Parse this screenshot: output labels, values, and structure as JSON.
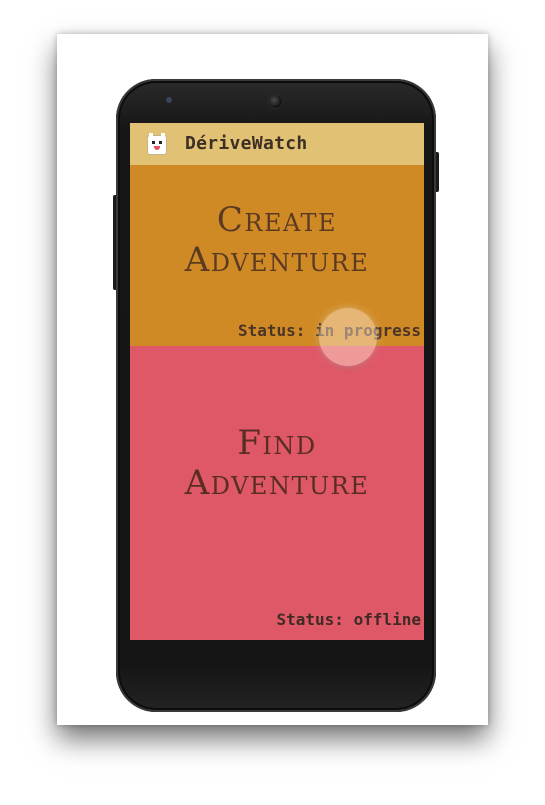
{
  "app": {
    "title": "DériveWatch",
    "icon": "app-mascot-icon"
  },
  "create_panel": {
    "title_line1": "Create",
    "title_line2": "Adventure",
    "status_label": "Status:",
    "status_value": "in progress",
    "background": "#d08a25"
  },
  "find_panel": {
    "title_line1": "Find",
    "title_line2": "Adventure",
    "status_label": "Status:",
    "status_value": "offline",
    "background": "#df5867"
  },
  "colors": {
    "app_bar": "#e1c173",
    "text": "#4a3426"
  }
}
